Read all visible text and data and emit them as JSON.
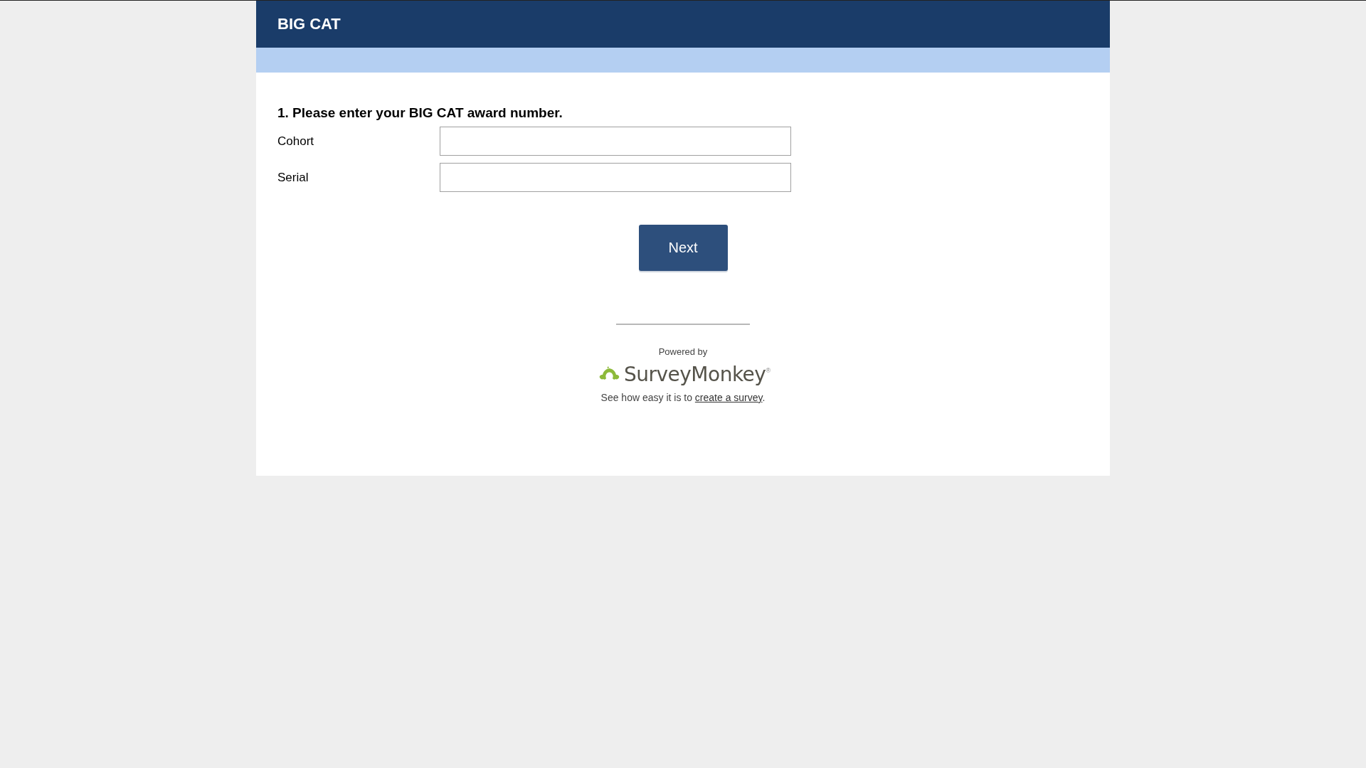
{
  "header": {
    "title": "BIG CAT"
  },
  "question": {
    "title": "1. Please enter your BIG CAT award number.",
    "fields": [
      {
        "label": "Cohort"
      },
      {
        "label": "Serial"
      }
    ]
  },
  "next_button": "Next",
  "footer": {
    "powered_by": "Powered by",
    "brand": "SurveyMonkey",
    "brand_mark": "®",
    "note_prefix": "See how easy it is to ",
    "note_link": "create a survey",
    "note_suffix": "."
  }
}
